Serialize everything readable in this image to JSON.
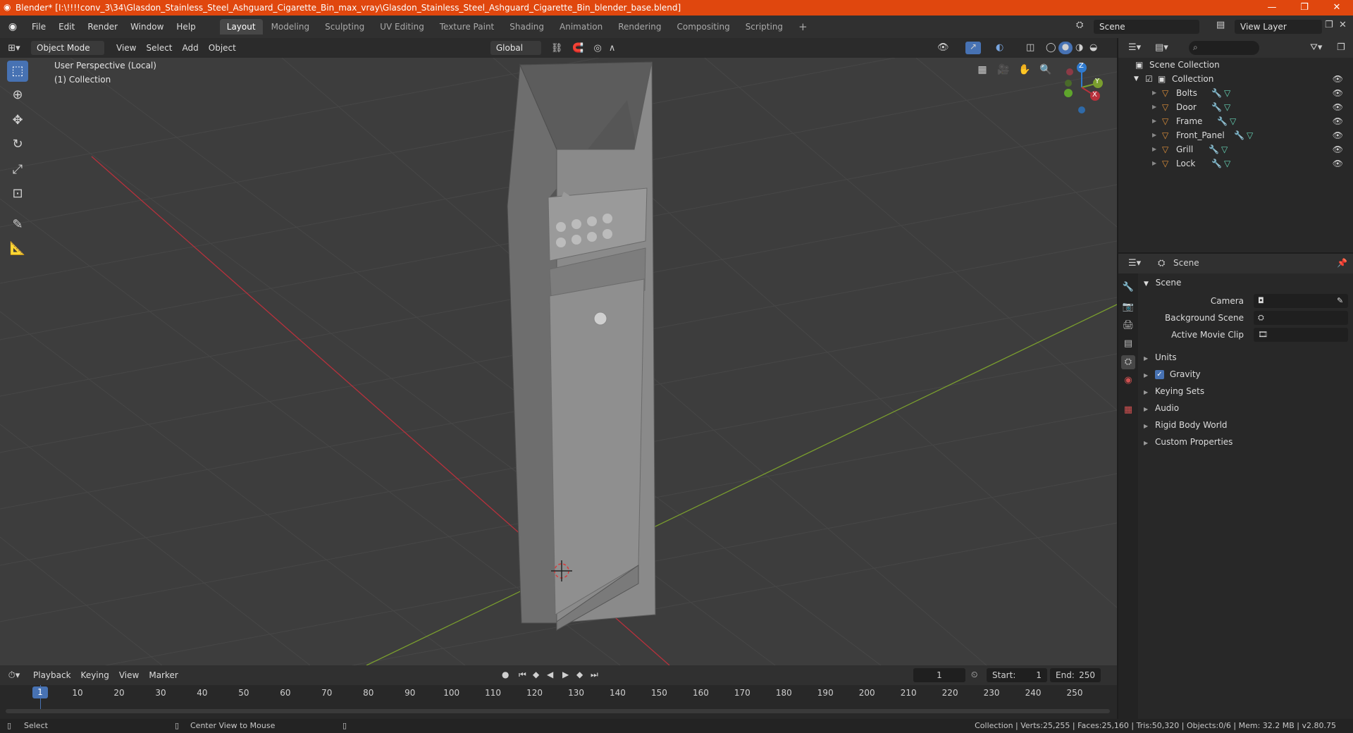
{
  "titlebar": {
    "title": "Blender* [I:\\!!!!conv_3\\34\\Glasdon_Stainless_Steel_Ashguard_Cigarette_Bin_max_vray\\Glasdon_Stainless_Steel_Ashguard_Cigarette_Bin_blender_base.blend]",
    "minimize": "—",
    "maximize": "❐",
    "close": "✕"
  },
  "menubar": {
    "items": [
      "File",
      "Edit",
      "Render",
      "Window",
      "Help"
    ],
    "workspaces": [
      "Layout",
      "Modeling",
      "Sculpting",
      "UV Editing",
      "Texture Paint",
      "Shading",
      "Animation",
      "Rendering",
      "Compositing",
      "Scripting"
    ],
    "active_workspace": "Layout",
    "add_tab": "+",
    "scene": "Scene",
    "view_layer": "View Layer"
  },
  "viewport_header": {
    "mode": "Object Mode",
    "menus": [
      "View",
      "Select",
      "Add",
      "Object"
    ],
    "orientation": "Global"
  },
  "viewport": {
    "perspective": "User Perspective (Local)",
    "collection": "(1) Collection",
    "gizmo": {
      "z": "Z",
      "y": "Y",
      "x": "X"
    },
    "colors": {
      "x_axis": "#b8313c",
      "y_axis": "#7a9e2e",
      "z_axis": "#2f7bd0",
      "grid_bg": "#3d3d3d"
    }
  },
  "outliner": {
    "root": "Scene Collection",
    "collection": "Collection",
    "objects": [
      "Bolts",
      "Door",
      "Frame",
      "Front_Panel",
      "Grill",
      "Lock"
    ]
  },
  "properties": {
    "header": "Scene",
    "panel": "Scene",
    "fields": [
      "Camera",
      "Background Scene",
      "Active Movie Clip"
    ],
    "sections": [
      "Units",
      "Gravity",
      "Keying Sets",
      "Audio",
      "Rigid Body World",
      "Custom Properties"
    ],
    "gravity_checked": true
  },
  "timeline": {
    "menus": [
      "Playback",
      "Keying",
      "View",
      "Marker"
    ],
    "current_frame": "1",
    "start_label": "Start:",
    "start": "1",
    "end_label": "End:",
    "end": "250",
    "ticks": [
      "1",
      "10",
      "20",
      "30",
      "40",
      "50",
      "60",
      "70",
      "80",
      "90",
      "100",
      "110",
      "120",
      "130",
      "140",
      "150",
      "160",
      "170",
      "180",
      "190",
      "200",
      "210",
      "220",
      "230",
      "240",
      "250"
    ]
  },
  "statusbar": {
    "select": "Select",
    "center_view": "Center View to Mouse",
    "stats": "Collection | Verts:25,255 | Faces:25,160 | Tris:50,320 | Objects:0/6 | Mem: 32.2 MB | v2.80.75"
  }
}
